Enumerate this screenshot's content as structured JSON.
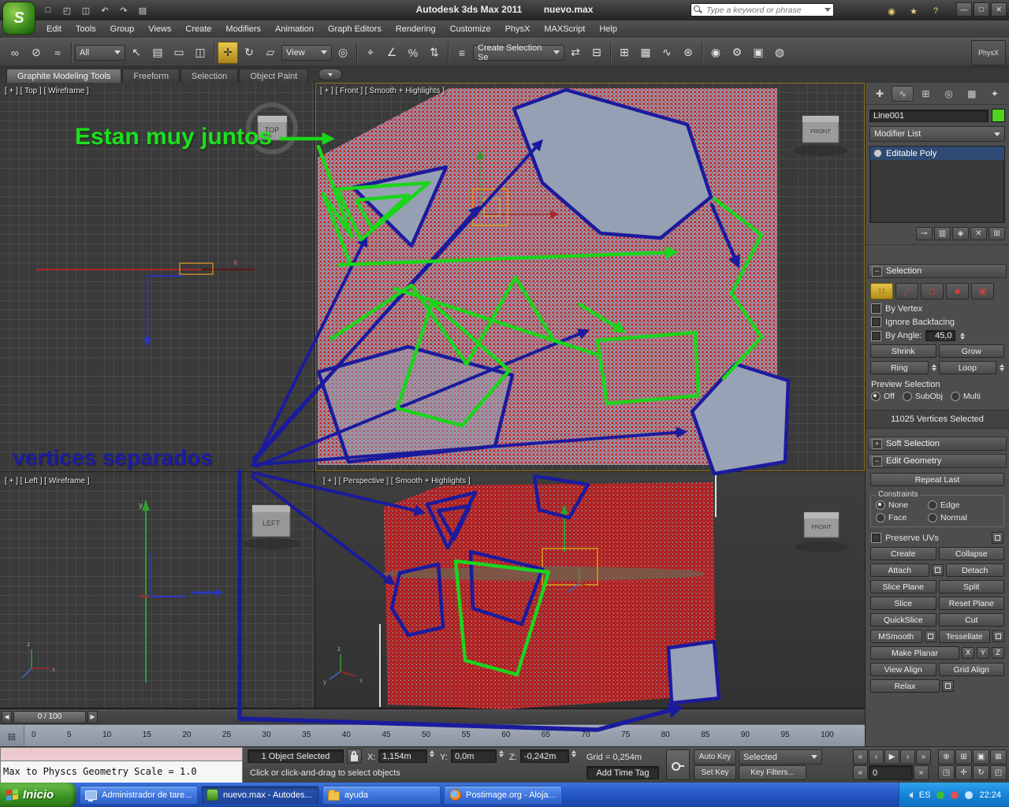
{
  "titlebar": {
    "logo_glyph": "S",
    "app_title": "Autodesk 3ds Max  2011",
    "doc_name": "nuevo.max",
    "search_placeholder": "Type a keyword or phrase",
    "icons": [
      "□",
      "◰",
      "◫",
      "↶",
      "↷",
      "▤"
    ],
    "right_icons": [
      "◉",
      "★",
      "?"
    ],
    "window_icons": [
      "—",
      "□",
      "✕"
    ]
  },
  "menu": {
    "items": [
      "Edit",
      "Tools",
      "Group",
      "Views",
      "Create",
      "Modifiers",
      "Animation",
      "Graph Editors",
      "Rendering",
      "Customize",
      "PhysX",
      "MAXScript",
      "Help"
    ]
  },
  "toolbar": {
    "all_dropdown": "All",
    "view_dropdown": "View",
    "selection_set_dropdown": "Create Selection Se",
    "physx_label": "PhysX",
    "icons": [
      "∞",
      "⊘",
      "≈",
      "↖",
      "▤",
      "▭",
      "◫",
      "✛",
      "↻",
      "▱",
      "◎",
      "⌖",
      "∠",
      "%",
      "⇅",
      "≡",
      "⇄",
      "⊟",
      "⊞",
      "▦",
      "∿",
      "⊛",
      "◉",
      "⚙",
      "▣",
      "◍"
    ]
  },
  "ribbon": {
    "tabs": [
      "Graphite Modeling Tools",
      "Freeform",
      "Selection",
      "Object Paint"
    ]
  },
  "viewports": {
    "top": {
      "label": "[ + ] [ Top ] [ Wireframe ]",
      "widget": "TOP"
    },
    "front": {
      "label": "[ + ] [ Front ] [ Smooth + Highlights ]",
      "widget": "FRONT"
    },
    "left": {
      "label": "[ + ] [ Left ] [ Wireframe ]",
      "widget": "LEFT"
    },
    "perspective": {
      "label": "[ + ] [ Perspective ] [ Smooth + Highlights ]",
      "widget": "FRONT"
    },
    "axis_labels": {
      "x": "x",
      "y": "y",
      "z": "z"
    },
    "annotations": {
      "green_note": "Estan muy juntos",
      "blue_note": "vertices separados",
      "green_color": "#1de01d",
      "blue_color": "#1c1ca2"
    }
  },
  "command_panel": {
    "tab_icons": [
      "✚",
      "∿",
      "⊞",
      "◎",
      "▦",
      "✦"
    ],
    "object_name": "Line001",
    "object_color": "#4ed41e",
    "modifier_list_label": "Modifier List",
    "stack": [
      "Editable Poly"
    ],
    "stack_icons": [
      "⊸",
      "▥",
      "◈",
      "✕",
      "⊞"
    ],
    "rollout_glyphs": {
      "minus": "−",
      "plus": "+"
    },
    "selection": {
      "title": "Selection",
      "subobject_icons": [
        "∷",
        "╱",
        "◻",
        "■",
        "▣"
      ],
      "by_vertex": "By Vertex",
      "ignore_backfacing": "Ignore Backfacing",
      "by_angle": "By Angle:",
      "by_angle_value": "45,0",
      "shrink": "Shrink",
      "grow": "Grow",
      "ring": "Ring",
      "loop": "Loop",
      "preview_label": "Preview Selection",
      "preview_options": [
        "Off",
        "SubObj",
        "Multi"
      ],
      "status_text": "11025 Vertices Selected"
    },
    "soft_selection_title": "Soft Selection",
    "edit_geometry": {
      "title": "Edit Geometry",
      "repeat_last": "Repeat Last",
      "constraints_label": "Constraints",
      "constraint_options": [
        "None",
        "Edge",
        "Face",
        "Normal"
      ],
      "preserve_uvs": "Preserve UVs",
      "create": "Create",
      "collapse": "Collapse",
      "attach": "Attach",
      "detach": "Detach",
      "slice_plane": "Slice Plane",
      "split": "Split",
      "slice": "Slice",
      "reset_plane": "Reset Plane",
      "quickslice": "QuickSlice",
      "cut": "Cut",
      "msmooth": "MSmooth",
      "tessellate": "Tessellate",
      "make_planar": "Make Planar",
      "axes": [
        "X",
        "Y",
        "Z"
      ],
      "view_align": "View Align",
      "grid_align": "Grid Align",
      "relax": "Relax"
    }
  },
  "timeline": {
    "slider_value": "0 / 100",
    "ticks": [
      "0",
      "5",
      "10",
      "15",
      "20",
      "25",
      "30",
      "35",
      "40",
      "45",
      "50",
      "55",
      "60",
      "65",
      "70",
      "75",
      "80",
      "85",
      "90",
      "95",
      "100"
    ]
  },
  "status_bar": {
    "listener_text": "Max to Physcs Geometry Scale = 1.0",
    "selection_info": "1 Object Selected",
    "x_label": "X:",
    "x_value": "1,154m",
    "y_label": "Y:",
    "y_value": "0,0m",
    "z_label": "Z:",
    "z_value": "-0,242m",
    "grid_info": "Grid = 0,254m",
    "prompt": "Click or click-and-drag to select objects",
    "add_time_tag": "Add Time Tag",
    "auto_key": "Auto Key",
    "set_key": "Set Key",
    "key_mode": "Selected",
    "key_filters": "Key Filters...",
    "frame_value": "0",
    "playback_icons": [
      "«",
      "‹",
      "▶",
      "›",
      "»"
    ],
    "frame_step_icons": [
      "«",
      "»"
    ],
    "nav_icons": [
      "⊕",
      "⊞",
      "▣",
      "⊠",
      "◳",
      "✛",
      "↻",
      "◰"
    ]
  },
  "taskbar": {
    "start_label": "Inicio",
    "tasks": [
      {
        "label": "Administrador de tare..."
      },
      {
        "label": "nuevo.max - Autodes...",
        "active": true
      },
      {
        "label": "ayuda"
      },
      {
        "label": "Postimage.org - Aloja..."
      }
    ],
    "language": "ES",
    "clock": "22:24"
  }
}
